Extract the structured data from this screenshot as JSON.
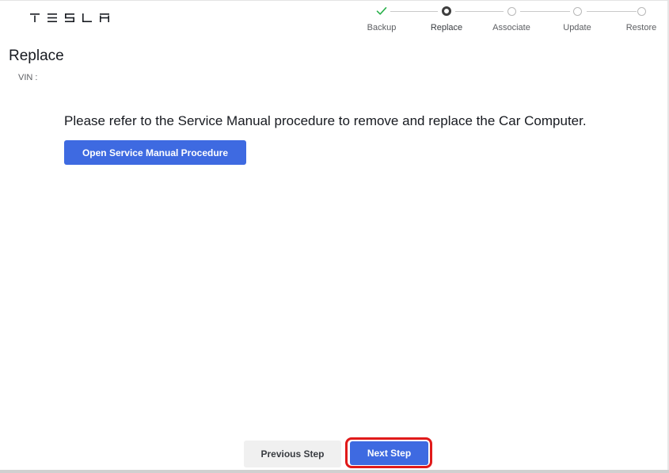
{
  "header": {
    "brand": "TESLA",
    "logo_icon": "tesla-wordmark-icon"
  },
  "stepper": {
    "steps": [
      {
        "label": "Backup",
        "state": "complete",
        "icon": "checkmark-icon"
      },
      {
        "label": "Replace",
        "state": "current",
        "icon": "current-step-icon"
      },
      {
        "label": "Associate",
        "state": "pending",
        "icon": "empty-circle-icon"
      },
      {
        "label": "Update",
        "state": "pending",
        "icon": "empty-circle-icon"
      },
      {
        "label": "Restore",
        "state": "pending",
        "icon": "empty-circle-icon"
      }
    ],
    "colors": {
      "complete": "#2bb14c",
      "current": "#3e3e3e",
      "pending": "#b8b8b8"
    }
  },
  "main": {
    "title": "Replace",
    "vin_label": "VIN :",
    "vin_value": "",
    "instruction": "Please refer to the Service Manual procedure to remove and replace the Car Computer.",
    "open_manual_button": "Open Service Manual Procedure"
  },
  "footer": {
    "previous_button": "Previous Step",
    "next_button": "Next Step",
    "highlight_color": "#e01a1a"
  },
  "colors": {
    "accent": "#3e6ae1",
    "secondary_button_bg": "#f0f0f0"
  }
}
